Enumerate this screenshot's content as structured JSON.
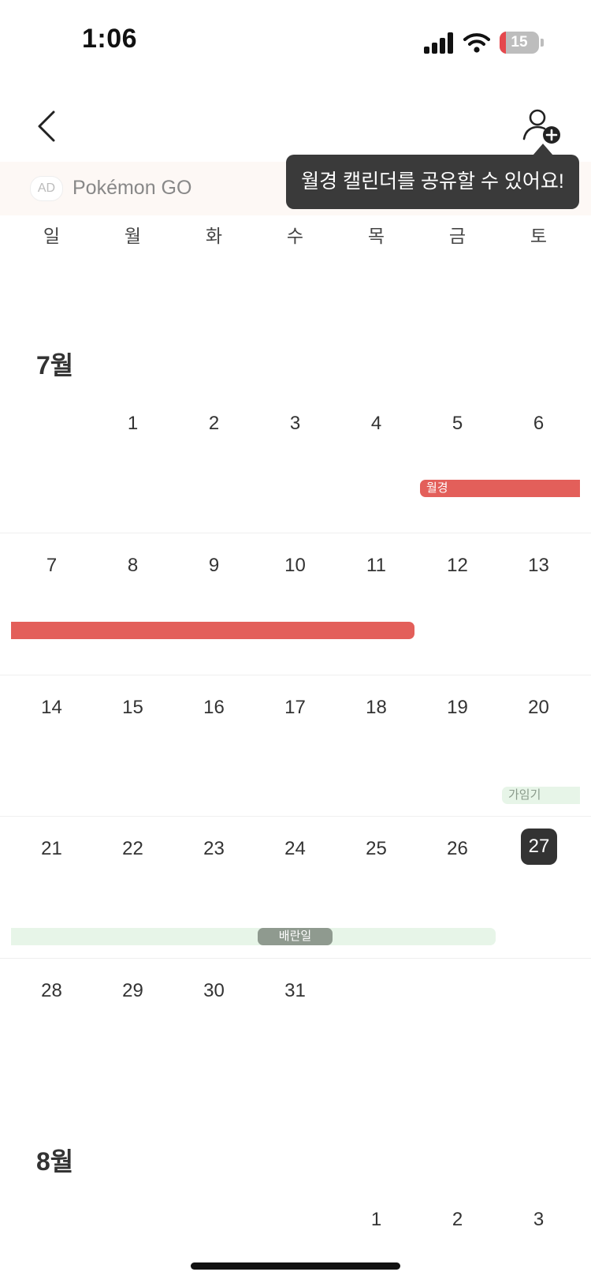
{
  "status_bar": {
    "time": "1:06",
    "battery": "15"
  },
  "ad": {
    "badge": "AD",
    "text": "Pokémon GO"
  },
  "tooltip": {
    "text": "월경 캘린더를 공유할 수 있어요!"
  },
  "weekdays": [
    "일",
    "월",
    "화",
    "수",
    "목",
    "금",
    "토"
  ],
  "months": [
    {
      "label": "7월",
      "weeks": [
        [
          "",
          "1",
          "2",
          "3",
          "4",
          "5",
          "6"
        ],
        [
          "7",
          "8",
          "9",
          "10",
          "11",
          "12",
          "13"
        ],
        [
          "14",
          "15",
          "16",
          "17",
          "18",
          "19",
          "20"
        ],
        [
          "21",
          "22",
          "23",
          "24",
          "25",
          "26",
          "27"
        ],
        [
          "28",
          "29",
          "30",
          "31",
          "",
          "",
          ""
        ]
      ],
      "today": "27"
    },
    {
      "label": "8월",
      "weeks": [
        [
          "",
          "",
          "",
          "",
          "1",
          "2",
          "3"
        ]
      ]
    }
  ],
  "events": {
    "period_label": "월경",
    "fertile_label": "가임기",
    "ovulation_label": "배란일"
  },
  "colors": {
    "period": "#e35f5a",
    "fertile": "#e7f5e8",
    "ovulation": "#8f9a8f",
    "today_bg": "#333333",
    "tooltip_bg": "#3a3a3a"
  },
  "icons": {
    "back": "chevron-left-icon",
    "share": "person-add-icon"
  }
}
